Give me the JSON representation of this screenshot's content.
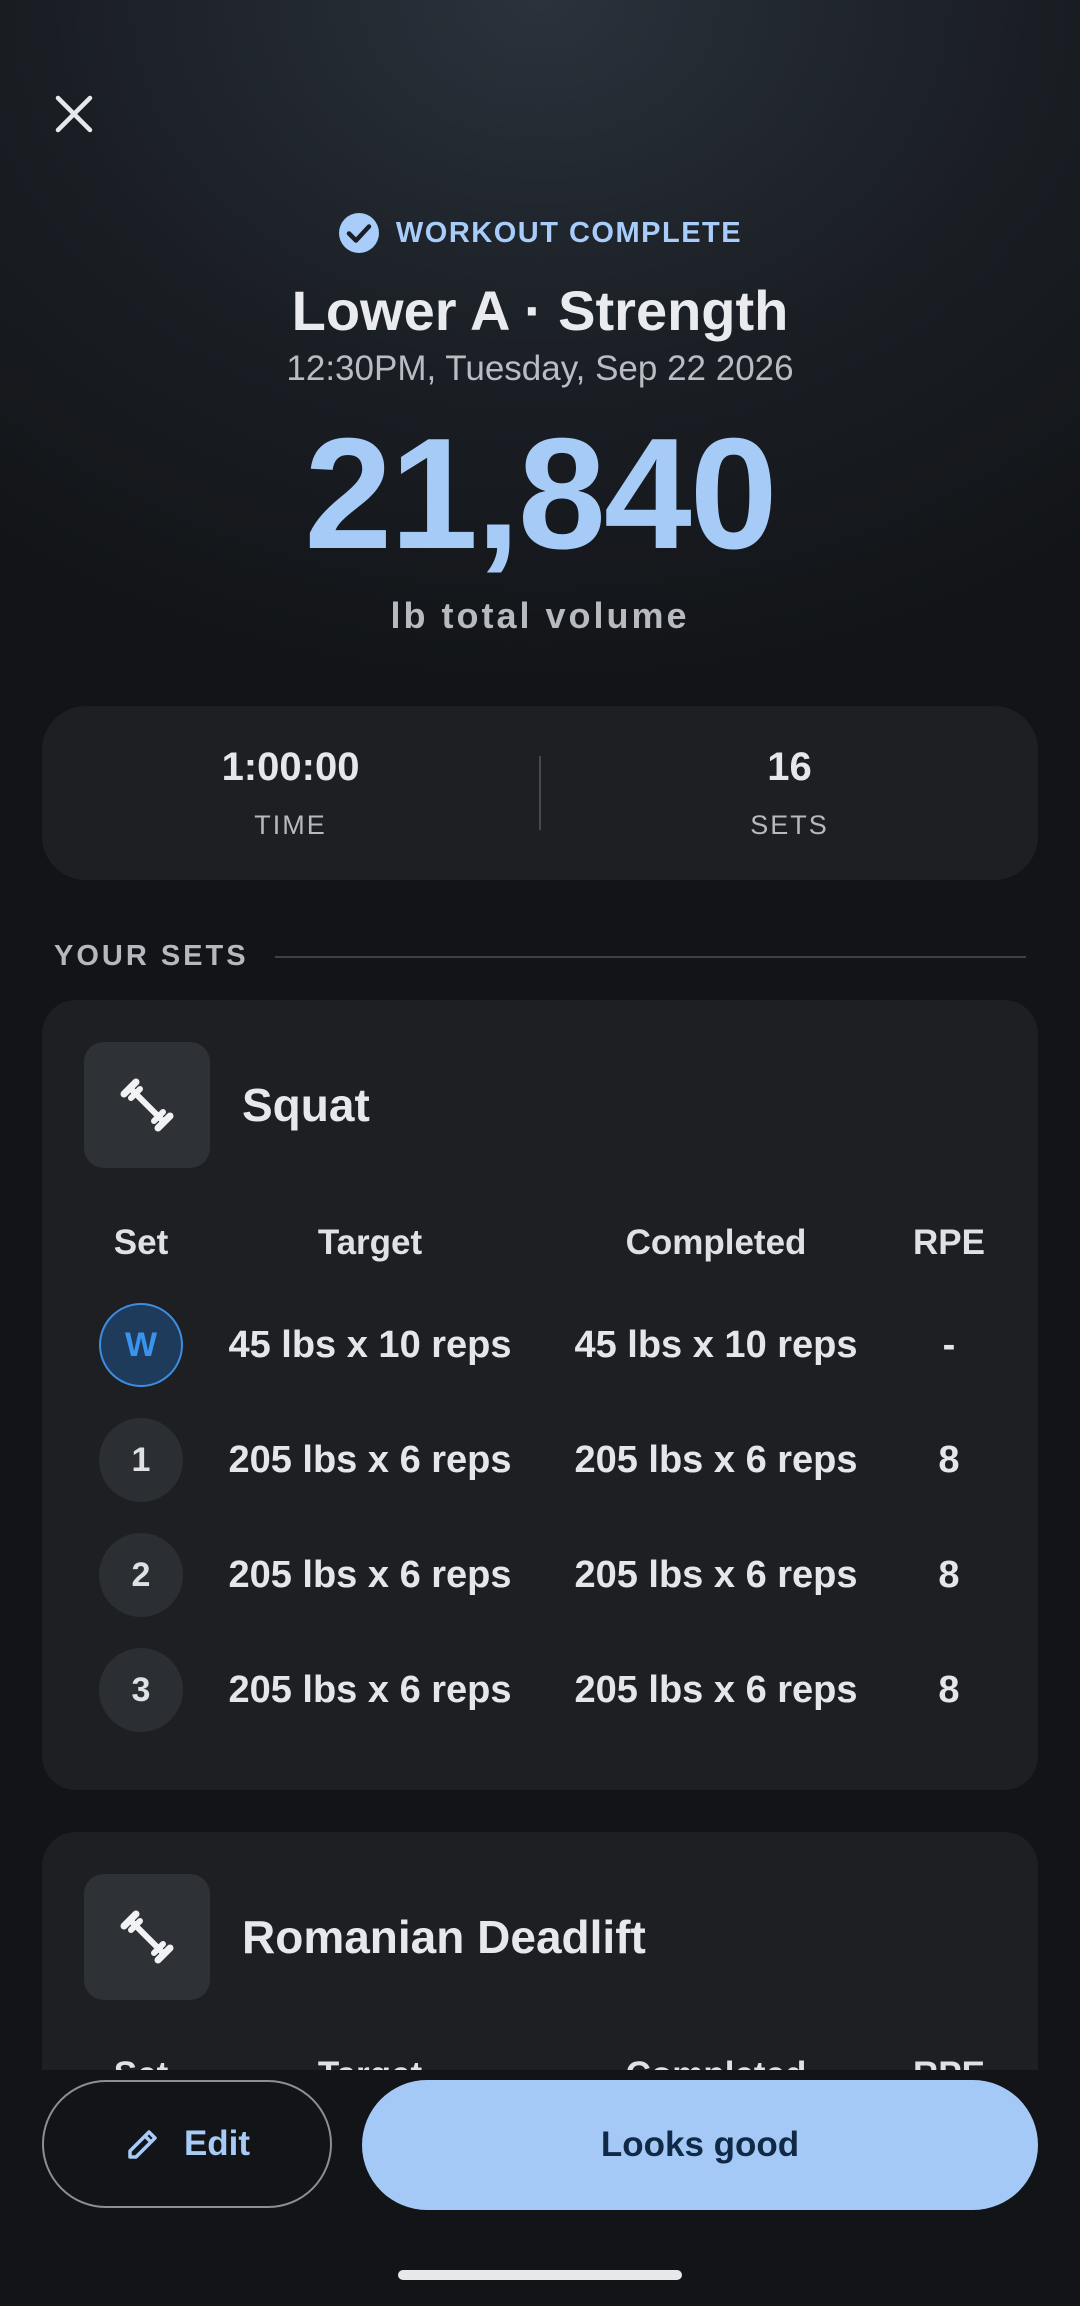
{
  "header": {
    "status": "WORKOUT COMPLETE",
    "title": "Lower A · Strength",
    "date": "12:30PM, Tuesday, Sep 22 2026",
    "volume": "21,840",
    "volume_label": "lb total volume"
  },
  "stats": {
    "time_value": "1:00:00",
    "time_label": "TIME",
    "sets_value": "16",
    "sets_label": "SETS"
  },
  "section": {
    "label": "YOUR SETS"
  },
  "columns": {
    "set": "Set",
    "target": "Target",
    "completed": "Completed",
    "rpe": "RPE"
  },
  "exercises": [
    {
      "name": "Squat",
      "icon": "barbell-icon",
      "rows": [
        {
          "set": "W",
          "target": "45 lbs x 10 reps",
          "completed": "45 lbs x 10 reps",
          "rpe": "-"
        },
        {
          "set": "1",
          "target": "205 lbs x 6 reps",
          "completed": "205 lbs x 6 reps",
          "rpe": "8"
        },
        {
          "set": "2",
          "target": "205 lbs x 6 reps",
          "completed": "205 lbs x 6 reps",
          "rpe": "8"
        },
        {
          "set": "3",
          "target": "205 lbs x 6 reps",
          "completed": "205 lbs x 6 reps",
          "rpe": "8"
        }
      ]
    },
    {
      "name": "Romanian Deadlift",
      "icon": "barbell-icon"
    }
  ],
  "actions": {
    "edit": "Edit",
    "confirm": "Looks good"
  },
  "colors": {
    "accent": "#a5c9f7",
    "background": "#121417",
    "card": "#1d1f23",
    "warmup": "#3b93ee"
  }
}
